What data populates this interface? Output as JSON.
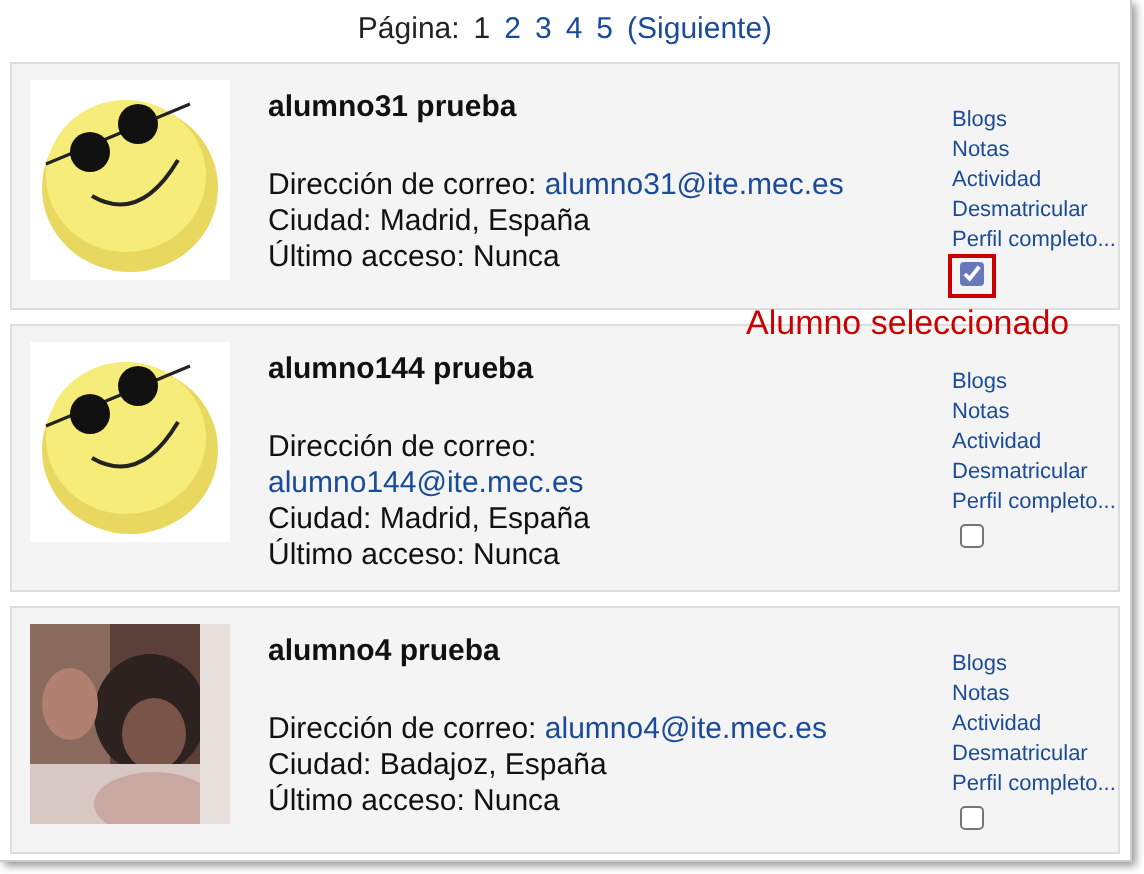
{
  "pagination": {
    "label": "Página:",
    "pages": [
      {
        "label": "1",
        "selected": true
      },
      {
        "label": "2",
        "selected": false
      },
      {
        "label": "3",
        "selected": false
      },
      {
        "label": "4",
        "selected": false
      },
      {
        "label": "5",
        "selected": false
      }
    ],
    "next": "(Siguiente)"
  },
  "students": [
    {
      "name": "alumno31 prueba",
      "avatar": {
        "kind": "smiley"
      },
      "email_label": "Dirección de correo:",
      "email": "alumno31@ite.mec.es",
      "city": "Ciudad: Madrid, España",
      "last_access": "Último acceso: Nunca",
      "links": [
        "Blogs",
        "Notas",
        "Actividad",
        "Desmatricular",
        "Perfil completo..."
      ],
      "checked": true,
      "annotation": "Alumno seleccionado"
    },
    {
      "name": "alumno144 prueba",
      "avatar": {
        "kind": "smiley"
      },
      "email_label": "Dirección de correo:",
      "email": "alumno144@ite.mec.es",
      "city": "Ciudad: Madrid, España",
      "last_access": "Último acceso: Nunca",
      "links": [
        "Blogs",
        "Notas",
        "Actividad",
        "Desmatricular",
        "Perfil completo..."
      ],
      "checked": false
    },
    {
      "name": "alumno4 prueba",
      "email_label": "Dirección de correo:",
      "email": "alumno4@ite.mec.es",
      "city": "Ciudad: Badajoz, España",
      "last_access": "Último acceso: Nunca",
      "links": [
        "Blogs",
        "Notas",
        "Actividad",
        "Desmatricular",
        "Perfil completo..."
      ],
      "checked": false
    }
  ]
}
